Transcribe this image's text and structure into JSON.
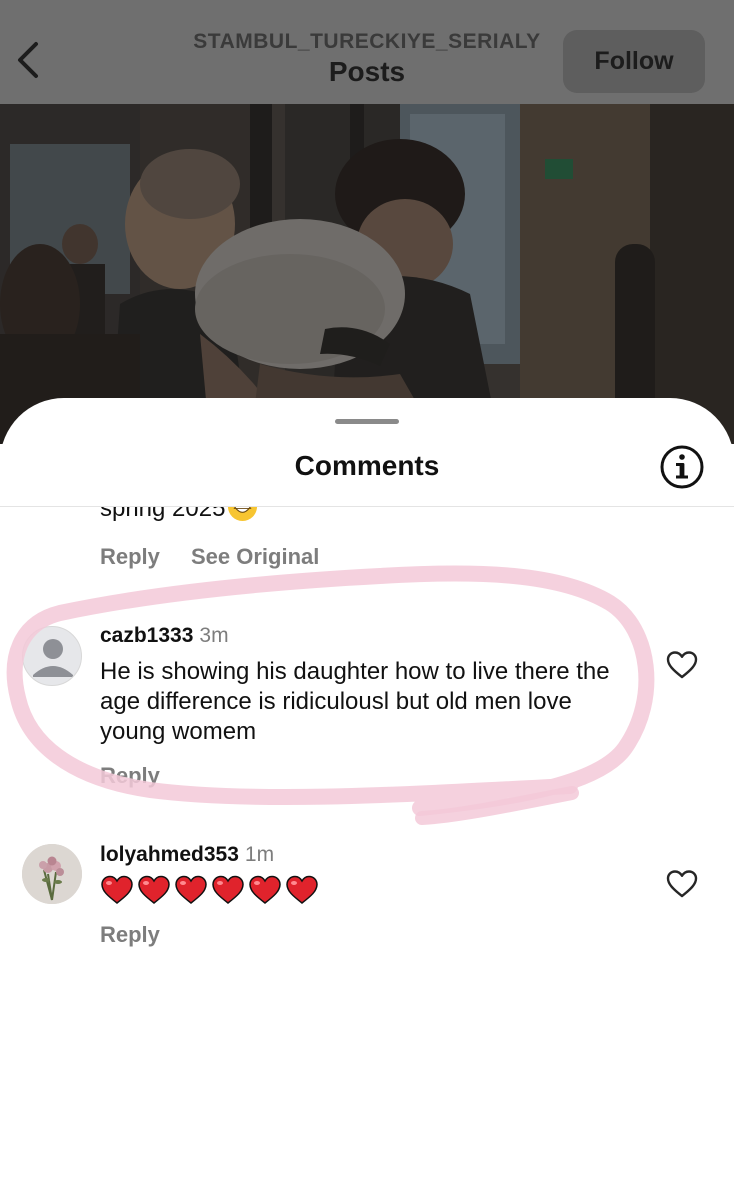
{
  "header": {
    "account": "STAMBUL_TURECKIYE_SERIALY",
    "title": "Posts",
    "follow_label": "Follow"
  },
  "sheet": {
    "title": "Comments"
  },
  "partial_comment": {
    "text": "spring 2025",
    "emoji": "grinning-face-emoji",
    "reply_label": "Reply",
    "see_original_label": "See Original"
  },
  "comments": [
    {
      "username": "cazb1333",
      "time": "3m",
      "text": "He is showing his daughter how to live there the age difference is ridiculousl but old men love young womem",
      "reply_label": "Reply",
      "avatar": "default-avatar",
      "highlighted": true
    },
    {
      "username": "lolyahmed353",
      "time": "1m",
      "text": "❤️❤️❤️❤️❤️❤️",
      "reply_label": "Reply",
      "avatar": "flowers-avatar",
      "highlighted": false
    }
  ],
  "colors": {
    "overlay": "#6f6f6f",
    "secondary_text": "#7d7d7d",
    "highlight_ring": "#f3c9d8",
    "heart_red": "#e0232c"
  }
}
